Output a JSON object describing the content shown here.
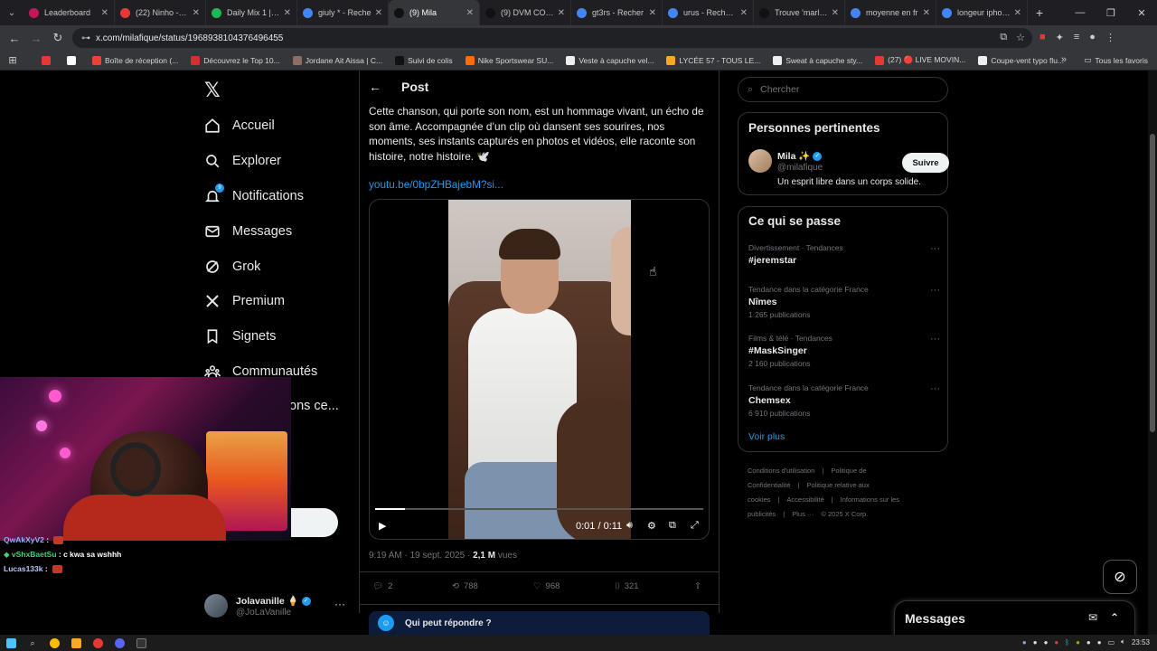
{
  "browser": {
    "tabs": [
      {
        "label": "Leaderboard",
        "color": "#c2185b",
        "active": false
      },
      {
        "label": "(22) Ninho - Ye",
        "color": "#e53935",
        "active": false
      },
      {
        "label": "Daily Mix 1 | Sp",
        "color": "#1db954",
        "active": false
      },
      {
        "label": "giuly * - Reche",
        "color": "#4285f4",
        "active": false
      },
      {
        "label": "(9) Mila",
        "color": "#111111",
        "active": true
      },
      {
        "label": "(9) DVM CORP",
        "color": "#111111",
        "active": false
      },
      {
        "label": "gt3rs - Recher",
        "color": "#4285f4",
        "active": false
      },
      {
        "label": "urus - Recherc",
        "color": "#4285f4",
        "active": false
      },
      {
        "label": "Trouve 'marlon",
        "color": "#111111",
        "active": false
      },
      {
        "label": "moyenne en fr",
        "color": "#4285f4",
        "active": false
      },
      {
        "label": "longeur iphone",
        "color": "#4285f4",
        "active": false
      }
    ],
    "url": "x.com/milafique/status/1968938104376496455",
    "bookmarks": [
      {
        "label": "",
        "color": "#e53935"
      },
      {
        "label": "",
        "color": "#ffffff"
      },
      {
        "label": "Boîte de réception (...",
        "color": "#ea4335"
      },
      {
        "label": "Découvrez le Top 10...",
        "color": "#d32f2f"
      },
      {
        "label": "Jordane Ait Aissa | C...",
        "color": "#8d6e63"
      },
      {
        "label": "Suivi de colis",
        "color": "#111111"
      },
      {
        "label": "Nike Sportswear SU...",
        "color": "#ff6d00"
      },
      {
        "label": "Veste à capuche vel...",
        "color": "#eeeeee"
      },
      {
        "label": "LYCÉE 57 - TOUS LE...",
        "color": "#f9a825"
      },
      {
        "label": "Sweat à capuche sty...",
        "color": "#eeeeee"
      },
      {
        "label": "(27) 🔴 LIVE MOVIN...",
        "color": "#e53935"
      },
      {
        "label": "Coupe-vent typo flu...",
        "color": "#eeeeee"
      }
    ],
    "all_bookmarks": "Tous les favoris"
  },
  "nav": {
    "items": [
      {
        "label": "Accueil",
        "icon": "home-icon"
      },
      {
        "label": "Explorer",
        "icon": "search-icon"
      },
      {
        "label": "Notifications",
        "icon": "bell-icon",
        "badge": "9"
      },
      {
        "label": "Messages",
        "icon": "mail-icon"
      },
      {
        "label": "Grok",
        "icon": "grok-icon"
      },
      {
        "label": "Premium",
        "icon": "x-premium-icon"
      },
      {
        "label": "Signets",
        "icon": "bookmark-icon"
      },
      {
        "label": "Communautés",
        "icon": "communities-icon"
      }
    ],
    "partial_item": "ons ce..."
  },
  "account": {
    "name": "Jolavanille 🍦",
    "handle": "@JoLaVanille"
  },
  "post": {
    "header": "Post",
    "text": "Cette chanson, qui porte son nom, est un hommage vivant, un écho de son âme. Accompagnée d’un clip où dansent ses sourires, nos moments, ses instants capturés en photos et vidéos, elle raconte son histoire, notre histoire. 🕊️",
    "link": "youtu.be/0bpZHBajebM?si...",
    "video": {
      "time": "0:01 / 0:11",
      "progress": 0.09
    },
    "timestamp": "9:19 AM · 19 sept. 2025 · ",
    "views": "2,1 M",
    "views_label": " vues",
    "replies": "2",
    "reposts": "788",
    "likes": "968",
    "bookmarks": "321",
    "reply_prompt": "Qui peut répondre ?"
  },
  "sidebar": {
    "search_placeholder": "Chercher",
    "relevant_title": "Personnes pertinentes",
    "person": {
      "name": "Mila ✨",
      "handle": "@milafique",
      "bio": "Un esprit libre dans un corps solide.",
      "follow": "Suivre"
    },
    "trends_title": "Ce qui se passe",
    "trends": [
      {
        "category": "Divertissement · Tendances",
        "name": "#jeremstar",
        "count": ""
      },
      {
        "category": "Tendance dans la catégorie France",
        "name": "Nîmes",
        "count": "1 265 publications"
      },
      {
        "category": "Films & télé · Tendances",
        "name": "#MaskSinger",
        "count": "2 160 publications"
      },
      {
        "category": "Tendance dans la catégorie France",
        "name": "Chemsex",
        "count": "6 910 publications"
      }
    ],
    "see_more": "Voir plus",
    "footer": [
      "Conditions d'utilisation",
      "|",
      "Politique de Confidentialité",
      "|",
      "Politique relative aux cookies",
      "|",
      "Accessibilité",
      "|",
      "Informations sur les publicités",
      "|",
      "Plus ···",
      "© 2025 X Corp."
    ]
  },
  "chat": [
    {
      "user": "QwAkXyV2",
      "message": ""
    },
    {
      "user": "vShxBaetSu",
      "message": "c kwa sa wshhh"
    },
    {
      "user": "Lucas133k",
      "message": ""
    }
  ],
  "messages_drawer": {
    "title": "Messages"
  },
  "taskbar": {
    "time": "23:53"
  }
}
